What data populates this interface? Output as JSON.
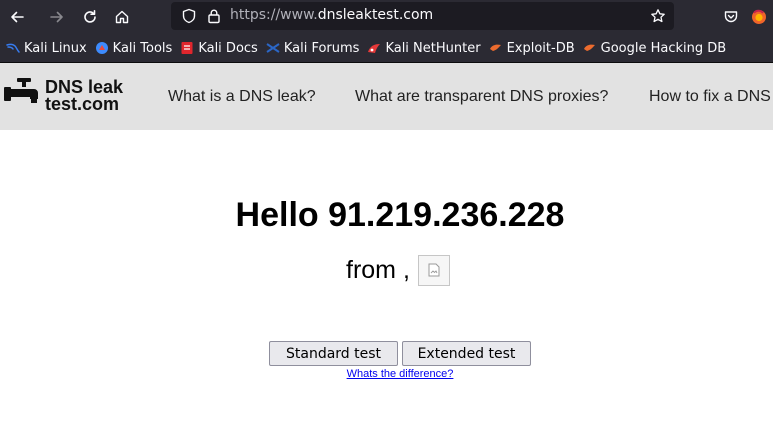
{
  "browser": {
    "url_prefix": "https://www.",
    "url_domain": "dnsleaktest.com",
    "bookmarks": [
      {
        "label": "Kali Linux",
        "icon": "kali-dragon-icon",
        "color": "#367bf0"
      },
      {
        "label": "Kali Tools",
        "icon": "kali-tools-icon",
        "color": "#3d8bfd"
      },
      {
        "label": "Kali Docs",
        "icon": "kali-docs-icon",
        "color": "#e0262d"
      },
      {
        "label": "Kali Forums",
        "icon": "kali-forums-icon",
        "color": "#2b66c6"
      },
      {
        "label": "Kali NetHunter",
        "icon": "kali-nethunter-icon",
        "color": "#e63939"
      },
      {
        "label": "Exploit-DB",
        "icon": "exploit-db-icon",
        "color": "#ec6b2e"
      },
      {
        "label": "Google Hacking DB",
        "icon": "ghdb-icon",
        "color": "#ec6b2e"
      }
    ]
  },
  "site": {
    "logo_line1": "DNS leak",
    "logo_line2": "test.com",
    "nav": [
      "What is a DNS leak?",
      "What are transparent DNS proxies?",
      "How to fix a DNS"
    ]
  },
  "main": {
    "hello": "Hello 91.219.236.228",
    "from": "from ,",
    "standard_test": "Standard test",
    "extended_test": "Extended test",
    "difference_link": "Whats the difference?"
  },
  "colors": {
    "chrome_bg": "#2b2a33",
    "urlbar_bg": "#1c1b22",
    "header_bg": "#e2e2e2",
    "link": "#0000ee"
  }
}
